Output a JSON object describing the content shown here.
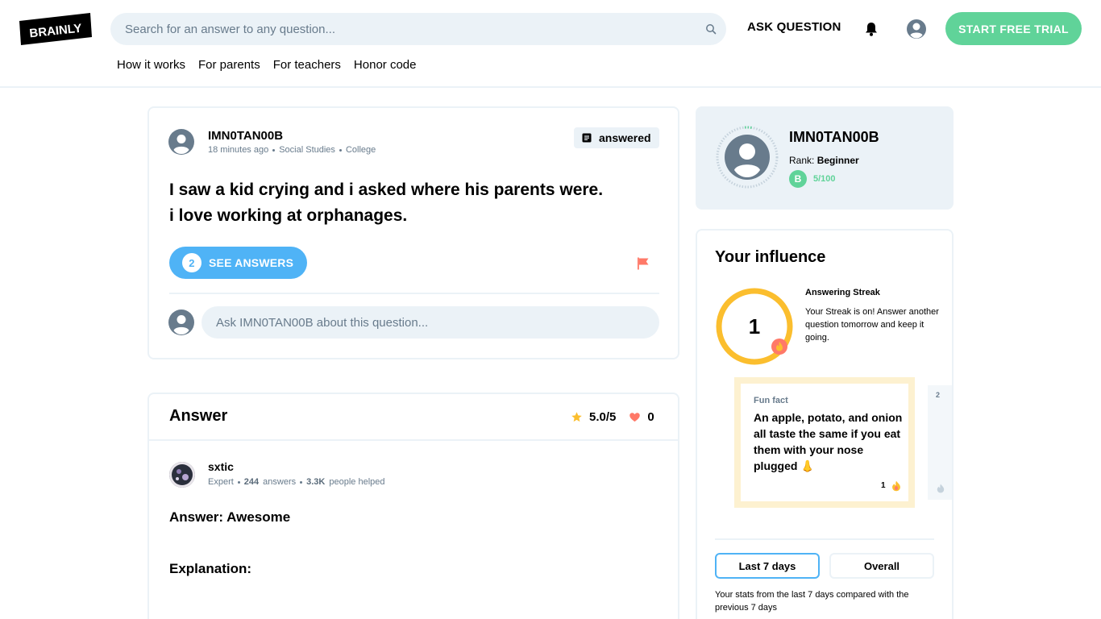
{
  "header": {
    "logo_text": "BRAINLY",
    "search_placeholder": "Search for an answer to any question...",
    "ask_question": "ASK QUESTION",
    "trial_button": "START FREE TRIAL",
    "nav": [
      "How it works",
      "For parents",
      "For teachers",
      "Honor code"
    ],
    "icons": [
      "search-icon",
      "bell-icon",
      "profile-icon"
    ]
  },
  "question": {
    "author": "IMN0TAN00B",
    "time": "18 minutes ago",
    "subject": "Social Studies",
    "level": "College",
    "status": "answered",
    "text_line1": "I saw a kid crying and i asked where his parents were.",
    "text_line2": "i love working at orphanages.",
    "answers_count": "2",
    "see_answers": "SEE ANSWERS",
    "comment_placeholder": "Ask IMN0TAN00B about this question..."
  },
  "answer": {
    "title": "Answer",
    "rating": "5.0/5",
    "likes": "0",
    "author": "sxtic",
    "author_rank": "Expert",
    "answers_count": "244",
    "answers_label": "answers",
    "helped_count": "3.3K",
    "helped_label": "people helped",
    "body_line1": "Answer: Awesome",
    "body_line2": "Explanation:"
  },
  "profile": {
    "name": "IMN0TAN00B",
    "rank_label": "Rank:",
    "rank_value": "Beginner",
    "points": "5/100",
    "coin_letter": "B"
  },
  "influence": {
    "title": "Your influence",
    "streak_value": "1",
    "streak_title": "Answering Streak",
    "streak_text": "Your Streak is on! Answer another question tomorrow and keep it going.",
    "funfact_label": "Fun fact",
    "funfact_text": "An apple, potato, and onion all taste the same if you eat them with your nose plugged 👃",
    "funfact_count": "1",
    "next_card_number": "2",
    "tabs": [
      "Last 7 days",
      "Overall"
    ],
    "active_tab": "Last 7 days",
    "note": "Your stats from the last 7 days compared with the previous 7 days"
  },
  "colors": {
    "green": "#60d399",
    "blue": "#4fb3f6",
    "gray_bg": "#ebf2f7",
    "streak_yellow": "#fbbe2e",
    "flag_red": "#ff7968"
  }
}
